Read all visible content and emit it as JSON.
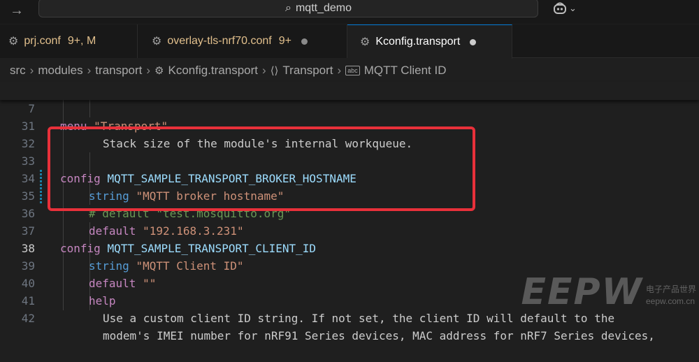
{
  "titlebar": {
    "back_icon": "arrow-right-icon",
    "search_text": "mqtt_demo",
    "copilot_icon": "copilot-icon"
  },
  "tabs": [
    {
      "name": "prj.conf",
      "badge": "9+, M",
      "icon": "gear-icon",
      "active": false
    },
    {
      "name": "overlay-tls-nrf70.conf",
      "badge": "9+",
      "icon": "gear-icon",
      "active": false,
      "dirty": true
    },
    {
      "name": "Kconfig.transport",
      "icon": "gear-icon",
      "active": true,
      "dirty": true
    }
  ],
  "breadcrumb": [
    "src",
    "modules",
    "transport",
    "Kconfig.transport",
    "Transport",
    "MQTT Client ID"
  ],
  "editor": {
    "sticky_line": {
      "num": "7",
      "kw": "menu",
      "str": "\"Transport\""
    },
    "lines": [
      {
        "num": "31",
        "text": "Stack size of the module's internal workqueue."
      },
      {
        "num": "32",
        "text": ""
      },
      {
        "num": "33",
        "kw": "config",
        "sym": "MQTT_SAMPLE_TRANSPORT_BROKER_HOSTNAME"
      },
      {
        "num": "34",
        "ty": "string",
        "str": "\"MQTT broker hostname\""
      },
      {
        "num": "35",
        "comment": "# default \"test.mosquitto.org\""
      },
      {
        "num": "36",
        "kw": "default",
        "str": "\"192.168.3.231\""
      },
      {
        "num": "37",
        "kw": "config",
        "sym": "MQTT_SAMPLE_TRANSPORT_CLIENT_ID"
      },
      {
        "num": "38",
        "ty": "string",
        "str": "\"MQTT Client ID\""
      },
      {
        "num": "39",
        "kw": "default",
        "str": "\"\""
      },
      {
        "num": "40",
        "kw": "help"
      },
      {
        "num": "41",
        "text": "Use a custom client ID string. If not set, the client ID will default to the"
      },
      {
        "num": "42",
        "text": "modem's IMEI number for nRF91 Series devices, MAC address for nRF7 Series devices,"
      }
    ]
  },
  "watermark": {
    "logo": "EEPW",
    "sub": "电子产品世界",
    "domain": "eepw.com.cn"
  },
  "colors": {
    "highlight_box": "#e8303a",
    "keyword": "#c586c0",
    "type": "#569cd6",
    "symbol": "#9cdcfe",
    "string": "#ce9178",
    "comment": "#6a9955"
  }
}
